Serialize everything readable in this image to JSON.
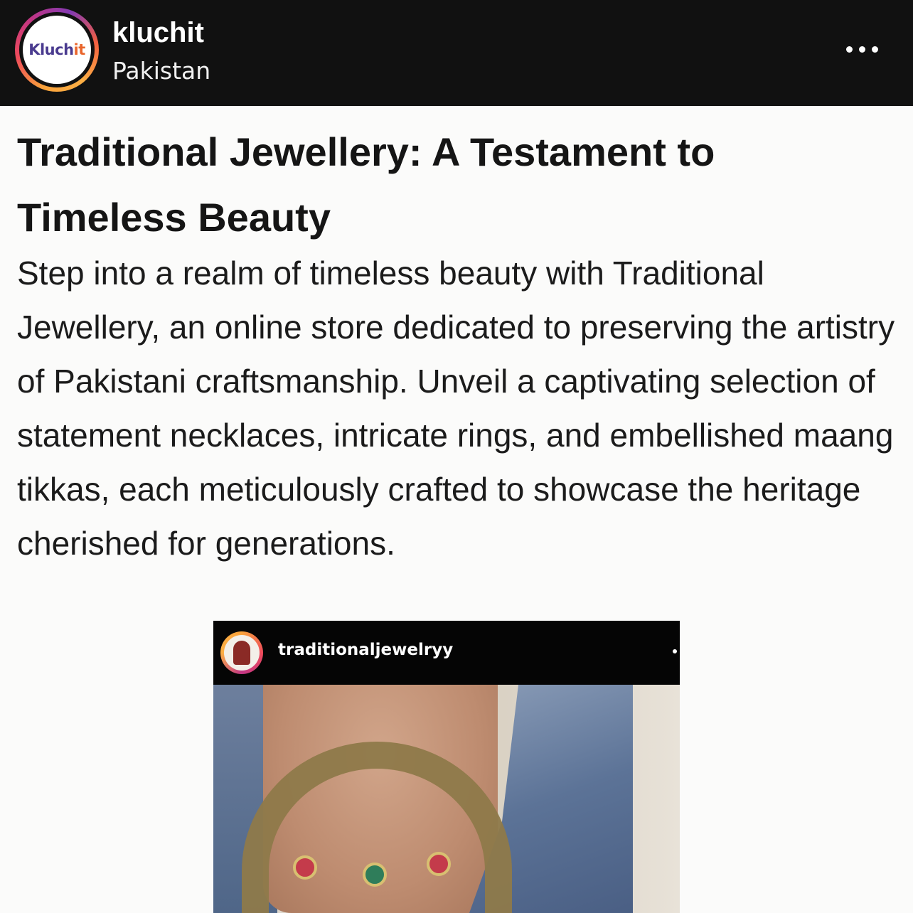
{
  "header": {
    "avatar_logo_text_main": "Kluch",
    "avatar_logo_text_accent": "it",
    "username": "kluchit",
    "location": "Pakistan",
    "more_icon": "more-horizontal-icon"
  },
  "post": {
    "title": "Traditional Jewellery: A Testament to Timeless Beauty",
    "body": "Step into a realm of timeless beauty with Traditional Jewellery, an online store dedicated to preserving the artistry of Pakistani craftsmanship. Unveil a captivating selection of statement necklaces, intricate rings, and embellished maang tikkas, each meticulously crafted to showcase the heritage cherished for generations."
  },
  "embed": {
    "username": "traditionaljewelryy"
  },
  "colors": {
    "header_bg": "#111111",
    "page_bg": "#fbfbfa",
    "text": "#151515"
  }
}
